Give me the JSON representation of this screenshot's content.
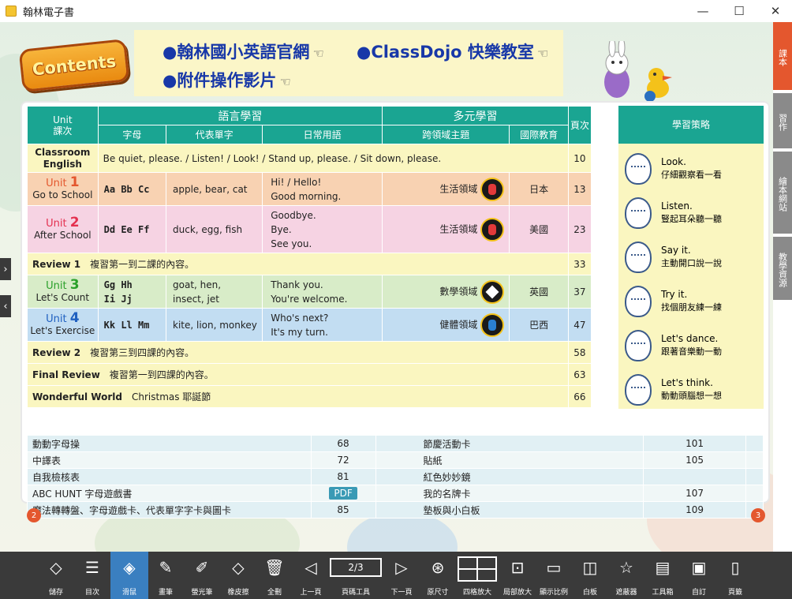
{
  "window": {
    "title": "翰林電子書",
    "minimize": "—",
    "maximize": "☐",
    "close": "✕"
  },
  "links": {
    "official": "●翰林國小英語官網",
    "classdojo": "●ClassDojo 快樂教室",
    "video": "●附件操作影片",
    "hand": "☜"
  },
  "contents_label": "Contents",
  "toc": {
    "headers": {
      "unit": "Unit\n課次",
      "lang": "語言學習",
      "multi": "多元學習",
      "page": "頁次",
      "strategy": "學習策略",
      "letters": "字母",
      "vocab": "代表單字",
      "phrases": "日常用語",
      "cross": "跨領域主題",
      "intl": "國際教育"
    },
    "classroom": {
      "name": "Classroom English",
      "content": "Be quiet, please. / Listen! / Look! / Stand up, please. / Sit down, please.",
      "page": "10"
    },
    "units": [
      {
        "unit": "Unit",
        "num": "1",
        "title": "Go to School",
        "color": "#e4572e",
        "letters": "Aa Bb Cc",
        "vocab": "apple, bear, cat",
        "phrases": [
          "Hi! / Hello!",
          "Good morning."
        ],
        "topic": "生活領域",
        "intl": "日本",
        "page": "13"
      },
      {
        "unit": "Unit",
        "num": "2",
        "title": "After School",
        "color": "#e4304f",
        "letters": "Dd Ee Ff",
        "vocab": "duck, egg, fish",
        "phrases": [
          "Goodbye.",
          "Bye.",
          "See you."
        ],
        "topic": "生活領域",
        "intl": "美國",
        "page": "23"
      }
    ],
    "review1": {
      "title": "Review 1",
      "desc": "複習第一到二課的內容。",
      "page": "33"
    },
    "units2": [
      {
        "unit": "Unit",
        "num": "3",
        "title": "Let's Count",
        "color": "#2aa02a",
        "letters": "Gg Hh\nIi Jj",
        "vocab": "goat, hen,\ninsect, jet",
        "phrases": [
          "Thank you.",
          "You're welcome."
        ],
        "topic": "數學領域",
        "intl": "英國",
        "page": "37"
      },
      {
        "unit": "Unit",
        "num": "4",
        "title": "Let's Exercise",
        "color": "#2060c0",
        "letters": "Kk Ll Mm",
        "vocab": "kite, lion, monkey",
        "phrases": [
          "Who's next?",
          "It's my turn."
        ],
        "topic": "健體領域",
        "intl": "巴西",
        "page": "47"
      }
    ],
    "review2": {
      "title": "Review 2",
      "desc": "複習第三到四課的內容。",
      "page": "58"
    },
    "final": {
      "title": "Final Review",
      "desc": "複習第一到四課的內容。",
      "page": "63"
    },
    "wonderful": {
      "title": "Wonderful World",
      "desc": "Christmas 耶誕節",
      "page": "66"
    }
  },
  "strategies": [
    {
      "en": "Look.",
      "zh": "仔細觀察看一看"
    },
    {
      "en": "Listen.",
      "zh": "豎起耳朵聽一聽"
    },
    {
      "en": "Say it.",
      "zh": "主動開口說一說"
    },
    {
      "en": "Try it.",
      "zh": "找個朋友練一練"
    },
    {
      "en": "Let's dance.",
      "zh": "跟著音樂動一動"
    },
    {
      "en": "Let's think.",
      "zh": "動動頭腦想一想"
    }
  ],
  "materials": [
    {
      "l": "動動字母操",
      "lp": "68",
      "r": "節慶活動卡",
      "rp": "101"
    },
    {
      "l": "中譯表",
      "lp": "72",
      "r": "貼紙",
      "rp": "105"
    },
    {
      "l": "自我檢核表",
      "lp": "81",
      "r": "紅色妙妙鏡",
      "rp": ""
    },
    {
      "l": "ABC HUNT 字母遊戲書",
      "lp": "PDF",
      "r": "我的名牌卡",
      "rp": "107"
    },
    {
      "l": "魔法轉轉盤、字母遊戲卡、代表單字字卡與圖卡",
      "lp": "85",
      "r": "墊板與小白板",
      "rp": "109"
    }
  ],
  "sidetabs": [
    {
      "label": "課本",
      "color": "#e4572e"
    },
    {
      "label": "習作",
      "color": "#8a8a8a"
    },
    {
      "label": "繪本網站",
      "color": "#8a8a8a"
    },
    {
      "label": "教學資源",
      "color": "#8a8a8a"
    }
  ],
  "page_indicators": {
    "left": "2",
    "right": "3"
  },
  "toolbar": {
    "page": "2/3",
    "items": [
      "儲存",
      "目次",
      "滑鼠",
      "畫筆",
      "螢光筆",
      "橡皮擦",
      "全刪",
      "上一頁",
      "頁碼工具",
      "下一頁",
      "原尺寸",
      "四格放大",
      "局部放大",
      "顯示比例",
      "白板",
      "遮蔽器",
      "工具箱",
      "自訂",
      "頁籤"
    ]
  }
}
